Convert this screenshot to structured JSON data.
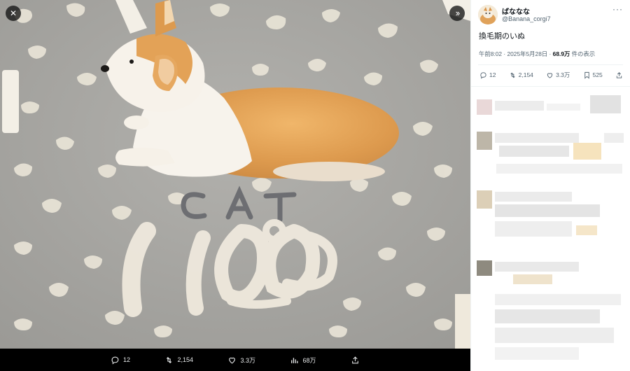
{
  "viewer": {
    "close_icon": "close-icon",
    "next_icon": "double-chevron-right-icon",
    "photo_description": "corgi-photo",
    "photo_lettering": "CAT 100%",
    "stats": {
      "replies": "12",
      "reposts": "2,154",
      "likes": "3.3万",
      "views": "68万"
    }
  },
  "tweet": {
    "display_name": "ばななな",
    "handle": "@Banana_corgi7",
    "text": "換毛期のいぬ",
    "meta_prefix": "午前8:02 · 2025年5月28日 · ",
    "views_count": "68.9万",
    "views_suffix": " 件の表示",
    "actions": {
      "replies": "12",
      "reposts": "2,154",
      "likes": "3.3万",
      "bookmarks": "525"
    }
  },
  "colors": {
    "floor": "#a9a8a4",
    "accent_text": "#536471",
    "panel_bg": "#ffffff"
  }
}
